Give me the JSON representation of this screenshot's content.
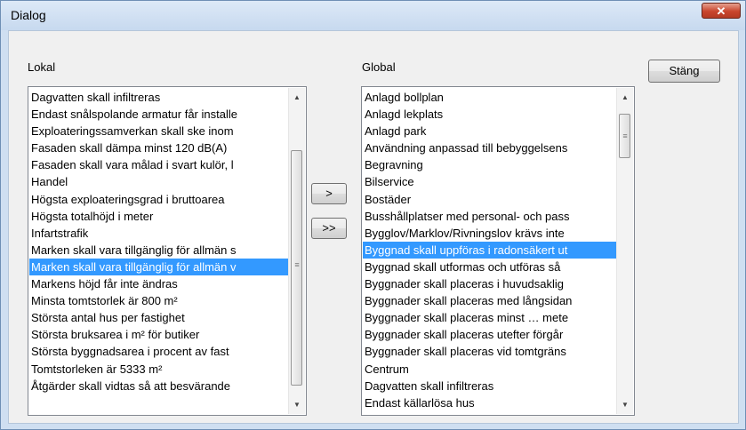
{
  "window": {
    "title": "Dialog",
    "close_glyph": "✕"
  },
  "local": {
    "label": "Lokal",
    "items": [
      "Dagvatten skall infiltreras",
      "Endast snålspolande armatur får installe",
      "Exploateringssamverkan skall ske inom",
      "Fasaden skall dämpa     minst 120 dB(A)",
      "Fasaden skall vara målad i svart kulör, l",
      "Handel",
      "Högsta exploateringsgrad i bruttoarea",
      "Högsta totalhöjd i meter",
      "Infartstrafik",
      "Marken skall vara tillgänglig för allmän s",
      "Marken skall vara tillgänglig för allmän v",
      "Markens höjd får inte ändras",
      "Minsta tomtstorlek är 800 m²",
      "Största antal hus per fastighet",
      "Största bruksarea i m² för butiker",
      "Största byggnadsarea i procent av fast",
      "Tomtstorleken är 5333 m²",
      "Åtgärder skall vidtas så att besvärande"
    ],
    "selected_index": 10
  },
  "global": {
    "label": "Global",
    "items": [
      "Anlagd bollplan",
      "Anlagd lekplats",
      "Anlagd park",
      "Användning anpassad till bebyggelsens",
      "Begravning",
      "Bilservice",
      "Bostäder",
      "Busshållplatser med personal- och pass",
      "Bygglov/Marklov/Rivningslov krävs inte",
      "Byggnad skall uppföras i radonsäkert ut",
      "Byggnad skall utformas och utföras så",
      "Byggnader skall placeras i huvudsaklig",
      "Byggnader skall placeras med långsidan",
      "Byggnader skall placeras minst … mete",
      "Byggnader skall placeras utefter förgår",
      "Byggnader skall placeras vid tomtgräns",
      "Centrum",
      "Dagvatten skall infiltreras",
      "Endast källarlösa hus"
    ],
    "selected_index": 9
  },
  "buttons": {
    "move_one": ">",
    "move_all": ">>",
    "close": "Stäng"
  },
  "scroll": {
    "up_glyph": "▲",
    "down_glyph": "▼",
    "grip_glyph": "≡"
  },
  "colors": {
    "selection": "#3399ff",
    "close_button": "#c9452d"
  }
}
